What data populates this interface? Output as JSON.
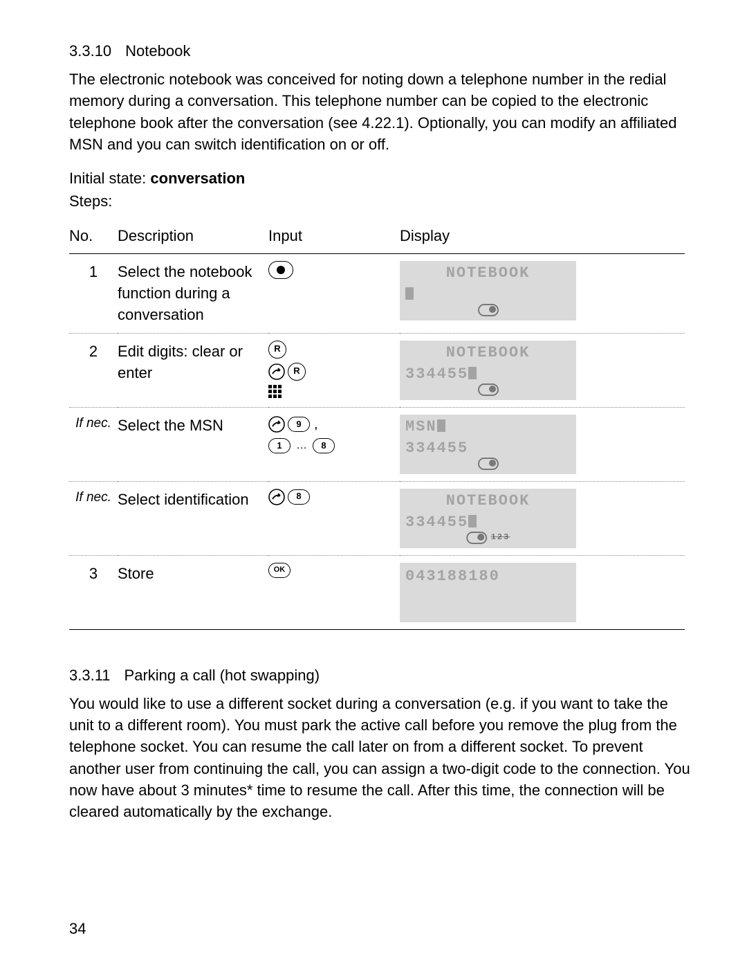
{
  "section1": {
    "number": "3.3.10",
    "title": "Notebook",
    "body": "The electronic notebook was conceived for noting down a telephone number in the redial memory during a conversation. This telephone number can be copied to the electronic telephone book after the conversation (see 4.22.1). Optionally, you can modify an affiliated MSN and you can switch identification on or off.",
    "initial_state_label": "Initial state:",
    "initial_state_value": "conversation",
    "steps_label": "Steps:"
  },
  "table": {
    "headers": {
      "no": "No.",
      "desc": "Description",
      "input": "Input",
      "display": "Display"
    },
    "rows": [
      {
        "no": "1",
        "desc": "Select the notebook function during a conversation",
        "input_icons": [
          "record"
        ],
        "display": {
          "line1": "NOTEBOOK",
          "line1_align": "center",
          "line2_cursor": true,
          "rec": true
        }
      },
      {
        "no": "2",
        "desc": "Edit digits: clear or enter",
        "input_icons": [
          "R",
          "shift+R",
          "keypad"
        ],
        "display": {
          "line1": "NOTEBOOK",
          "line1_align": "center",
          "line2": "334455",
          "line2_cursor": true,
          "rec": true
        }
      },
      {
        "no": "If nec.",
        "no_italic": true,
        "desc": "Select the MSN",
        "input_icons": [
          "shift+9",
          "1..8"
        ],
        "display": {
          "line1": "MSN",
          "line1_align": "left",
          "line1_cursor": true,
          "line2": "334455",
          "rec": true
        }
      },
      {
        "no": "If nec.",
        "no_italic": true,
        "desc": "Select identification",
        "input_icons": [
          "shift+8"
        ],
        "display": {
          "line1": "NOTEBOOK",
          "line1_align": "center",
          "line2": "334455",
          "line2_cursor": true,
          "rec": true,
          "rec_extra": "123"
        }
      },
      {
        "no": "3",
        "desc": "Store",
        "input_icons": [
          "OK"
        ],
        "display": {
          "line1": "043188180",
          "line1_align": "left",
          "plain": true
        }
      }
    ]
  },
  "section2": {
    "number": "3.3.11",
    "title": "Parking a call (hot swapping)",
    "body": "You would like to use a different socket during a conversation (e.g. if you want to take the unit to a different room). You must park the active call before you remove the plug from the telephone socket. You can resume the call later on from a different socket. To prevent another user from continuing the call, you can assign a two-digit code to the connection. You now have about 3 minutes* time to resume the call. After this time, the connection will be cleared automatically by the exchange."
  },
  "page_number": "34"
}
